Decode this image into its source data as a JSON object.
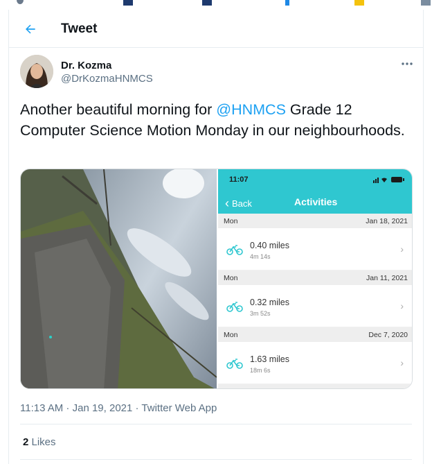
{
  "header": {
    "title": "Tweet",
    "back_icon": "arrow-left-icon"
  },
  "author": {
    "name": "Dr. Kozma",
    "handle": "@DrKozmaHNMCS"
  },
  "tweet": {
    "text_before": "Another beautiful morning for ",
    "mention": "@HNMCS",
    "text_after": " Grade 12 Computer Science Motion Monday in our neighbourhoods."
  },
  "phone": {
    "time": "11:07",
    "back_label": "Back",
    "title": "Activities",
    "activities": [
      {
        "day": "Mon",
        "date": "Jan 18, 2021",
        "miles": "0.40 miles",
        "duration": "4m 14s"
      },
      {
        "day": "Mon",
        "date": "Jan 11, 2021",
        "miles": "0.32 miles",
        "duration": "3m 52s"
      },
      {
        "day": "Mon",
        "date": "Dec 7, 2020",
        "miles": "1.63 miles",
        "duration": "18m 6s"
      }
    ]
  },
  "meta": {
    "time": "11:13 AM",
    "sep1": " · ",
    "date": "Jan 19, 2021",
    "sep2": " · ",
    "app": "Twitter Web App"
  },
  "likes": {
    "count": "2",
    "label": " Likes"
  },
  "colors": {
    "accent": "#1da1f2",
    "app_teal": "#2fc7d0"
  }
}
